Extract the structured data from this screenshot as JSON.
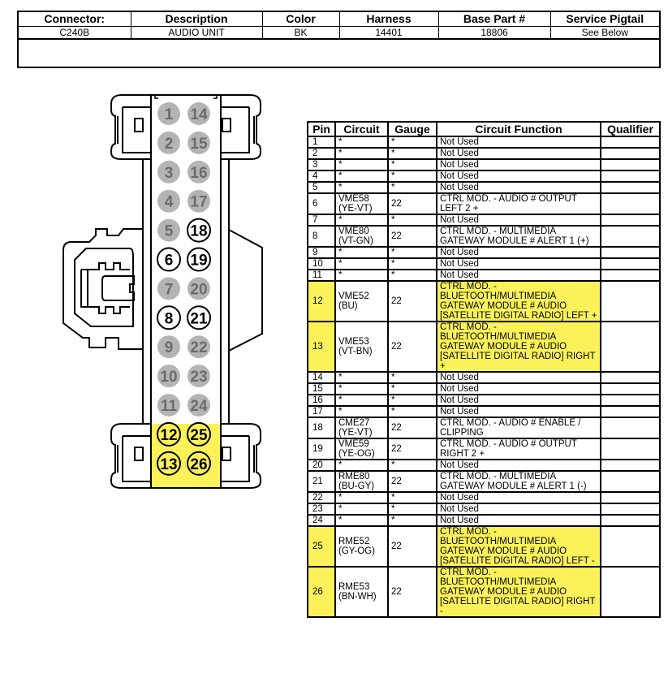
{
  "header": {
    "columns": [
      "Connector:",
      "Description",
      "Color",
      "Harness",
      "Base Part #",
      "Service Pigtail"
    ],
    "values": [
      "C240B",
      "AUDIO UNIT",
      "BK",
      "14401",
      "18806",
      "See Below"
    ],
    "notes": ""
  },
  "colors": {
    "highlight": "#fbf25a",
    "unused_pin": "#b4b4b4",
    "unused_pin_text": "#6b6b6b"
  },
  "connector": {
    "left_column": [
      {
        "pin": "1",
        "state": "unused"
      },
      {
        "pin": "2",
        "state": "unused"
      },
      {
        "pin": "3",
        "state": "unused"
      },
      {
        "pin": "4",
        "state": "unused"
      },
      {
        "pin": "5",
        "state": "unused"
      },
      {
        "pin": "6",
        "state": "used"
      },
      {
        "pin": "7",
        "state": "unused"
      },
      {
        "pin": "8",
        "state": "used"
      },
      {
        "pin": "9",
        "state": "unused"
      },
      {
        "pin": "10",
        "state": "unused"
      },
      {
        "pin": "11",
        "state": "unused"
      },
      {
        "pin": "12",
        "state": "highlight"
      },
      {
        "pin": "13",
        "state": "highlight"
      }
    ],
    "right_column": [
      {
        "pin": "14",
        "state": "unused"
      },
      {
        "pin": "15",
        "state": "unused"
      },
      {
        "pin": "16",
        "state": "unused"
      },
      {
        "pin": "17",
        "state": "unused"
      },
      {
        "pin": "18",
        "state": "used"
      },
      {
        "pin": "19",
        "state": "used"
      },
      {
        "pin": "20",
        "state": "unused"
      },
      {
        "pin": "21",
        "state": "used"
      },
      {
        "pin": "22",
        "state": "unused"
      },
      {
        "pin": "23",
        "state": "unused"
      },
      {
        "pin": "24",
        "state": "unused"
      },
      {
        "pin": "25",
        "state": "highlight"
      },
      {
        "pin": "26",
        "state": "highlight"
      }
    ]
  },
  "pin_table": {
    "columns": [
      "Pin",
      "Circuit",
      "Gauge",
      "Circuit Function",
      "Qualifier"
    ],
    "rows": [
      {
        "pin": "1",
        "circuit": "*",
        "gauge": "*",
        "function": "Not Used",
        "qualifier": "",
        "highlight": false
      },
      {
        "pin": "2",
        "circuit": "*",
        "gauge": "*",
        "function": "Not Used",
        "qualifier": "",
        "highlight": false
      },
      {
        "pin": "3",
        "circuit": "*",
        "gauge": "*",
        "function": "Not Used",
        "qualifier": "",
        "highlight": false
      },
      {
        "pin": "4",
        "circuit": "*",
        "gauge": "*",
        "function": "Not Used",
        "qualifier": "",
        "highlight": false
      },
      {
        "pin": "5",
        "circuit": "*",
        "gauge": "*",
        "function": "Not Used",
        "qualifier": "",
        "highlight": false
      },
      {
        "pin": "6",
        "circuit": "VME58 (YE-VT)",
        "gauge": "22",
        "function": "CTRL MOD. - AUDIO # OUTPUT LEFT 2 +",
        "qualifier": "",
        "highlight": false
      },
      {
        "pin": "7",
        "circuit": "*",
        "gauge": "*",
        "function": "Not Used",
        "qualifier": "",
        "highlight": false
      },
      {
        "pin": "8",
        "circuit": "VME80 (VT-GN)",
        "gauge": "22",
        "function": "CTRL MOD. - MULTIMEDIA GATEWAY MODULE # ALERT 1 (+)",
        "qualifier": "",
        "highlight": false
      },
      {
        "pin": "9",
        "circuit": "*",
        "gauge": "*",
        "function": "Not Used",
        "qualifier": "",
        "highlight": false
      },
      {
        "pin": "10",
        "circuit": "*",
        "gauge": "*",
        "function": "Not Used",
        "qualifier": "",
        "highlight": false
      },
      {
        "pin": "11",
        "circuit": "*",
        "gauge": "*",
        "function": "Not Used",
        "qualifier": "",
        "highlight": false
      },
      {
        "pin": "12",
        "circuit": "VME52 (BU)",
        "gauge": "22",
        "function": "CTRL MOD. - BLUETOOTH/MULTIMEDIA GATEWAY MODULE # AUDIO [SATELLITE DIGITAL RADIO] LEFT +",
        "qualifier": "",
        "highlight": true
      },
      {
        "pin": "13",
        "circuit": "VME53 (VT-BN)",
        "gauge": "22",
        "function": "CTRL MOD. - BLUETOOTH/MULTIMEDIA GATEWAY MODULE # AUDIO [SATELLITE DIGITAL RADIO] RIGHT +",
        "qualifier": "",
        "highlight": true
      },
      {
        "pin": "14",
        "circuit": "*",
        "gauge": "*",
        "function": "Not Used",
        "qualifier": "",
        "highlight": false
      },
      {
        "pin": "15",
        "circuit": "*",
        "gauge": "*",
        "function": "Not Used",
        "qualifier": "",
        "highlight": false
      },
      {
        "pin": "16",
        "circuit": "*",
        "gauge": "*",
        "function": "Not Used",
        "qualifier": "",
        "highlight": false
      },
      {
        "pin": "17",
        "circuit": "*",
        "gauge": "*",
        "function": "Not Used",
        "qualifier": "",
        "highlight": false
      },
      {
        "pin": "18",
        "circuit": "CME27 (YE-VT)",
        "gauge": "22",
        "function": "CTRL MOD. - AUDIO # ENABLE / CLIPPING",
        "qualifier": "",
        "highlight": false
      },
      {
        "pin": "19",
        "circuit": "VME59 (YE-OG)",
        "gauge": "22",
        "function": "CTRL MOD. - AUDIO # OUTPUT RIGHT 2 +",
        "qualifier": "",
        "highlight": false
      },
      {
        "pin": "20",
        "circuit": "*",
        "gauge": "*",
        "function": "Not Used",
        "qualifier": "",
        "highlight": false
      },
      {
        "pin": "21",
        "circuit": "RME80 (BU-GY)",
        "gauge": "22",
        "function": "CTRL MOD. - MULTIMEDIA GATEWAY MODULE # ALERT 1 (-)",
        "qualifier": "",
        "highlight": false
      },
      {
        "pin": "22",
        "circuit": "*",
        "gauge": "*",
        "function": "Not Used",
        "qualifier": "",
        "highlight": false
      },
      {
        "pin": "23",
        "circuit": "*",
        "gauge": "*",
        "function": "Not Used",
        "qualifier": "",
        "highlight": false
      },
      {
        "pin": "24",
        "circuit": "*",
        "gauge": "*",
        "function": "Not Used",
        "qualifier": "",
        "highlight": false
      },
      {
        "pin": "25",
        "circuit": "RME52 (GY-OG)",
        "gauge": "22",
        "function": "CTRL MOD. - BLUETOOTH/MULTIMEDIA GATEWAY MODULE # AUDIO [SATELLITE DIGITAL RADIO] LEFT -",
        "qualifier": "",
        "highlight": true
      },
      {
        "pin": "26",
        "circuit": "RME53 (BN-WH)",
        "gauge": "22",
        "function": "CTRL MOD. - BLUETOOTH/MULTIMEDIA GATEWAY MODULE # AUDIO [SATELLITE DIGITAL RADIO] RIGHT -",
        "qualifier": "",
        "highlight": true
      }
    ]
  }
}
